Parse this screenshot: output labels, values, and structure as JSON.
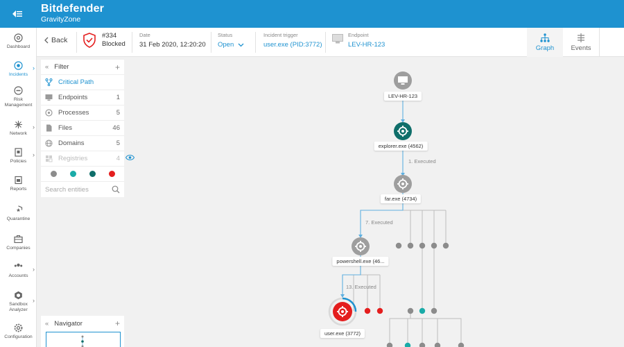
{
  "brand": {
    "name": "Bitdefender",
    "product": "GravityZone"
  },
  "nav": [
    {
      "id": "dashboard",
      "label": "Dashboard",
      "icon": "dashboard-icon",
      "active": false,
      "chevron": false
    },
    {
      "id": "incidents",
      "label": "Incidents",
      "icon": "incidents-icon",
      "active": true,
      "chevron": true
    },
    {
      "id": "risk",
      "label": "Risk Management",
      "icon": "risk-icon",
      "active": false,
      "chevron": false
    },
    {
      "id": "network",
      "label": "Network",
      "icon": "network-icon",
      "active": false,
      "chevron": true
    },
    {
      "id": "policies",
      "label": "Policies",
      "icon": "policies-icon",
      "active": false,
      "chevron": true
    },
    {
      "id": "reports",
      "label": "Reports",
      "icon": "reports-icon",
      "active": false,
      "chevron": false
    },
    {
      "id": "quarantine",
      "label": "Quarantine",
      "icon": "quarantine-icon",
      "active": false,
      "chevron": false
    },
    {
      "id": "companies",
      "label": "Companies",
      "icon": "companies-icon",
      "active": false,
      "chevron": false
    },
    {
      "id": "accounts",
      "label": "Accounts",
      "icon": "accounts-icon",
      "active": false,
      "chevron": true
    },
    {
      "id": "sandbox",
      "label": "Sandbox Analyzer",
      "icon": "sandbox-icon",
      "active": false,
      "chevron": true
    },
    {
      "id": "configuration",
      "label": "Configuration",
      "icon": "configuration-icon",
      "active": false,
      "chevron": false
    }
  ],
  "header": {
    "back_label": "Back",
    "incident_number": "#334",
    "incident_status": "Blocked",
    "date_label": "Date",
    "date_value": "31 Feb 2020, 12:20:20",
    "status_label": "Status",
    "status_value": "Open",
    "trigger_label": "Incident trigger",
    "trigger_value": "user.exe (PID:3772)",
    "endpoint_label": "Endpoint",
    "endpoint_value": "LEV-HR-123",
    "tabs": [
      {
        "label": "Graph",
        "active": true
      },
      {
        "label": "Events",
        "active": false
      }
    ]
  },
  "filter": {
    "title": "Filter",
    "critical_path": "Critical Path",
    "rows": [
      {
        "id": "endpoints",
        "label": "Endpoints",
        "count": "1",
        "icon": "monitor-icon",
        "disabled": false
      },
      {
        "id": "processes",
        "label": "Processes",
        "count": "5",
        "icon": "process-icon",
        "disabled": false
      },
      {
        "id": "files",
        "label": "Files",
        "count": "46",
        "icon": "file-icon",
        "disabled": false
      },
      {
        "id": "domains",
        "label": "Domains",
        "count": "5",
        "icon": "globe-icon",
        "disabled": false
      },
      {
        "id": "registries",
        "label": "Registries",
        "count": "4",
        "icon": "registry-icon",
        "disabled": true
      }
    ],
    "dots": [
      "#8c8c8c",
      "#1aaba8",
      "#0f6e6a",
      "#e41e1e"
    ],
    "search_placeholder": "Search entities"
  },
  "navigator": {
    "title": "Navigator"
  },
  "colors": {
    "accent": "#1e92d0",
    "gray": "#8c8c8c",
    "teal": "#1aaba8",
    "darkteal": "#0f6e6a",
    "red": "#e41e1e"
  },
  "graph": {
    "nodes": [
      {
        "id": "endpoint",
        "label": "LEV-HR-123",
        "kind": "endpoint-icon"
      },
      {
        "id": "explorer",
        "label": "explorer.exe (4562)",
        "kind": "process-icon"
      },
      {
        "id": "far",
        "label": "far.exe (4734)",
        "kind": "process-icon"
      },
      {
        "id": "powershell",
        "label": "powershell.exe (46...",
        "kind": "process-icon"
      },
      {
        "id": "user",
        "label": "user.exe (3772)",
        "kind": "process-icon"
      }
    ],
    "edges": [
      {
        "label": "1. Executed"
      },
      {
        "label": "7. Executed"
      },
      {
        "label": "13. Executed"
      }
    ]
  }
}
